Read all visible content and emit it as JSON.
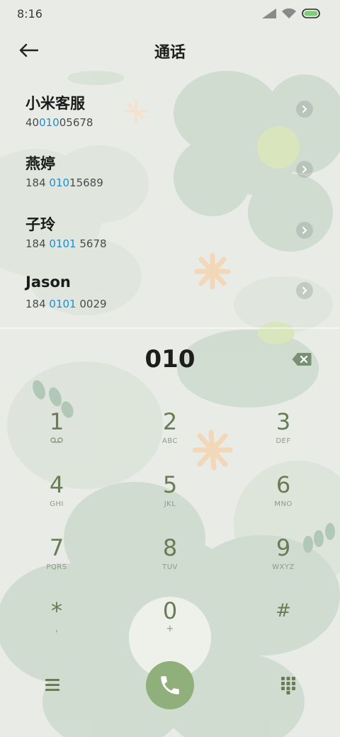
{
  "status_bar": {
    "time": "8:16",
    "icons": [
      "signal-icon",
      "wifi-icon",
      "battery-icon"
    ]
  },
  "header": {
    "title": "通话",
    "back_icon": "back-arrow-icon"
  },
  "contacts": [
    {
      "name": "小米客服",
      "number_parts": [
        "40",
        "010",
        "05678"
      ]
    },
    {
      "name": "燕婷",
      "number_parts": [
        "184 ",
        "010",
        "15689"
      ]
    },
    {
      "name": "子玲",
      "number_parts": [
        "184 ",
        "0101",
        " 5678"
      ]
    },
    {
      "name": "Jason",
      "number_parts": [
        "184 ",
        "0101",
        " 0029"
      ]
    }
  ],
  "dialer": {
    "number": "010",
    "backspace_icon": "backspace-icon"
  },
  "keypad": [
    {
      "digit": "1",
      "sub": "voicemail-icon"
    },
    {
      "digit": "2",
      "sub": "ABC"
    },
    {
      "digit": "3",
      "sub": "DEF"
    },
    {
      "digit": "4",
      "sub": "GHI"
    },
    {
      "digit": "5",
      "sub": "JKL"
    },
    {
      "digit": "6",
      "sub": "MNO"
    },
    {
      "digit": "7",
      "sub": "PQRS"
    },
    {
      "digit": "8",
      "sub": "TUV"
    },
    {
      "digit": "9",
      "sub": "WXYZ"
    },
    {
      "digit": "*",
      "sub": ","
    },
    {
      "digit": "0",
      "sub": "+"
    },
    {
      "digit": "#",
      "sub": ""
    }
  ],
  "bottom_bar": {
    "menu_icon": "menu-icon",
    "call_icon": "phone-icon",
    "keypad_icon": "dialpad-icon"
  },
  "colors": {
    "background": "#e9ebe6",
    "flower": "#bfd2c1",
    "accent_green": "#8fb07b",
    "key_text": "#6a7c55",
    "highlight_blue": "#1a8fd6"
  }
}
